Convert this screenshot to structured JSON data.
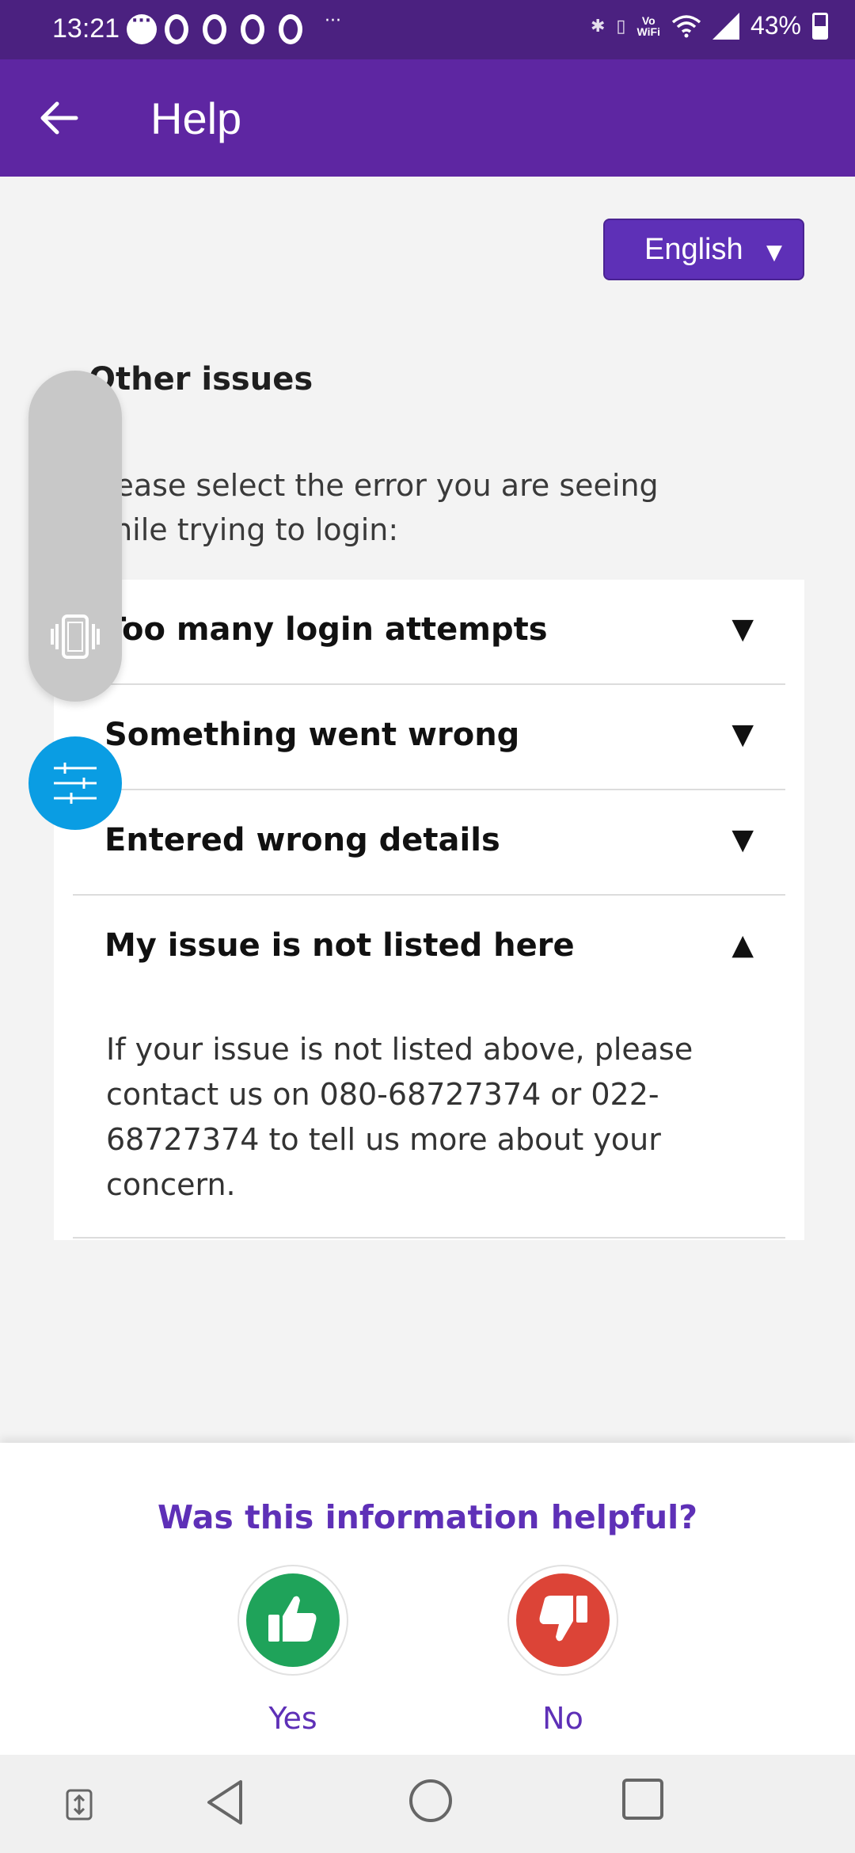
{
  "status_bar": {
    "time": "13:21",
    "more": "···",
    "battery": "43%",
    "vowifi_top": "Vo",
    "vowifi_bottom": "WiFi"
  },
  "app_bar": {
    "title": "Help"
  },
  "language": {
    "selected": "English",
    "caret": "▼"
  },
  "content": {
    "section_title": "Other issues",
    "prompt": "Please select the error you are seeing while trying to login:",
    "items": [
      {
        "label": "Too many login attempts",
        "caret": "▼"
      },
      {
        "label": "Something went wrong",
        "caret": "▼"
      },
      {
        "label": "Entered wrong details",
        "caret": "▼"
      },
      {
        "label": "My issue is not listed here",
        "caret": "▲"
      }
    ],
    "expanded_text": "If your issue is not listed above, please contact us on 080-68727374 or 022-68727374 to tell us more about your concern."
  },
  "feedback": {
    "question": "Was this information helpful?",
    "yes_label": "Yes",
    "no_label": "No",
    "yes_color": "#1fa35a",
    "no_color": "#dc4437"
  },
  "colors": {
    "status_bar": "#4b2180",
    "app_bar": "#5e26a2",
    "accent": "#5e30b7",
    "fab": "#0a9de3"
  }
}
